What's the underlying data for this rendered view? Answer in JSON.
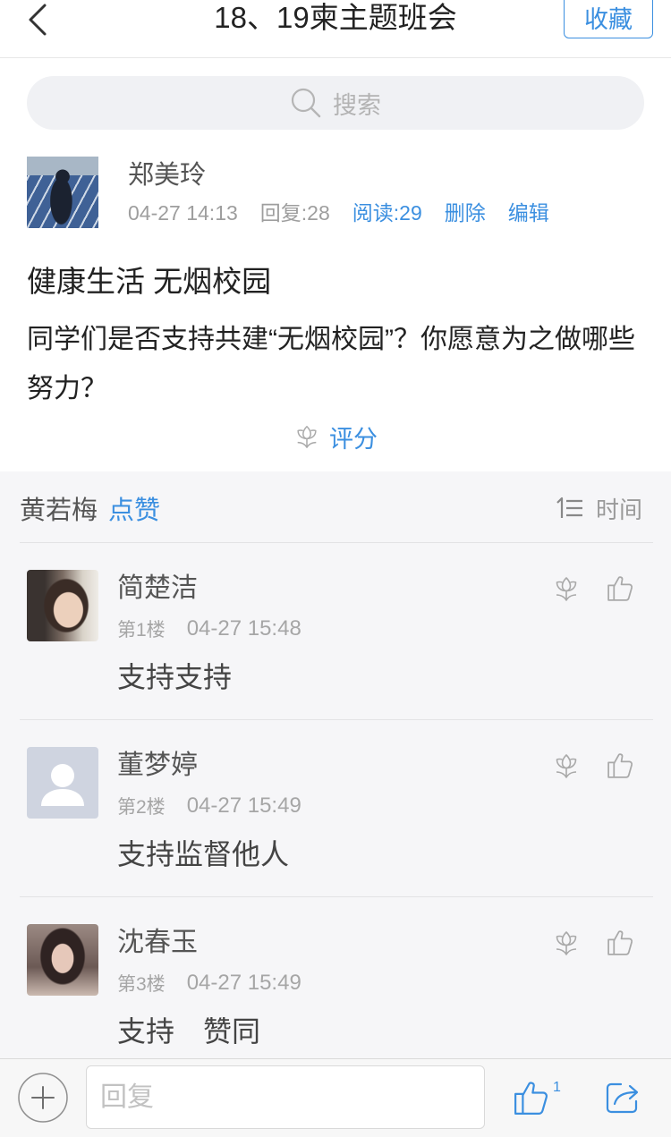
{
  "nav": {
    "title": "18、19柬主题班会",
    "collect_label": "收藏"
  },
  "search": {
    "placeholder": "搜索"
  },
  "post": {
    "author": "郑美玲",
    "time": "04-27 14:13",
    "reply": "回复:28",
    "read": "阅读:29",
    "delete_label": "删除",
    "edit_label": "编辑",
    "title": "健康生活 无烟校园",
    "body": "同学们是否支持共建“无烟校园”？你愿意为之做哪些努力？",
    "rate_label": "评分"
  },
  "likes": {
    "names": "黄若梅",
    "label": "点赞"
  },
  "sort": {
    "label": "时间"
  },
  "comments": [
    {
      "author": "简楚洁",
      "floor": "第1楼",
      "time": "04-27 15:48",
      "content": "支持支持"
    },
    {
      "author": "董梦婷",
      "floor": "第2楼",
      "time": "04-27 15:49",
      "content": "支持监督他人"
    },
    {
      "author": "沈春玉",
      "floor": "第3楼",
      "time": "04-27 15:49",
      "content": "支持　赞同"
    }
  ],
  "bottom": {
    "reply_placeholder": "回复",
    "like_count": "1"
  },
  "icons": {
    "back": "chevron-left-icon",
    "search": "search-icon",
    "rate": "flower-icon",
    "like": "thumbs-up-icon",
    "sort": "sort-icon",
    "add": "plus-circle-icon",
    "share": "share-icon"
  },
  "colors": {
    "accent": "#3b8fe0",
    "text": "#333333",
    "muted": "#9e9e9e",
    "list_bg": "#f6f6f8"
  }
}
